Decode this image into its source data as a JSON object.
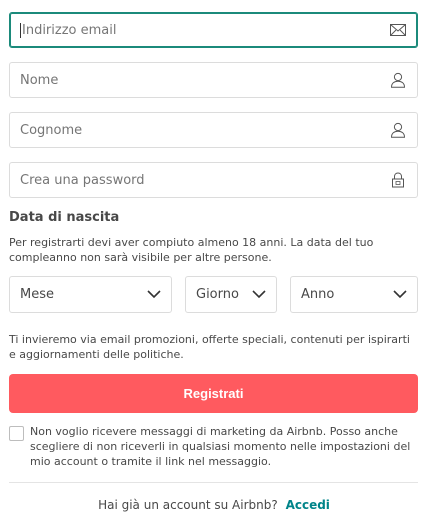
{
  "form": {
    "email": {
      "placeholder": "Indirizzo email",
      "icon": "mail-icon"
    },
    "first_name": {
      "placeholder": "Nome",
      "icon": "user-icon"
    },
    "last_name": {
      "placeholder": "Cognome",
      "icon": "user-icon"
    },
    "password": {
      "placeholder": "Crea una password",
      "icon": "lock-icon"
    }
  },
  "birthdate": {
    "title": "Data di nascita",
    "description": "Per registrarti devi aver compiuto almeno 18 anni. La data del tuo compleanno non sarà visibile per altre persone.",
    "month_label": "Mese",
    "day_label": "Giorno",
    "year_label": "Anno"
  },
  "marketing_notice": "Ti invieremo via email promozioni, offerte speciali, contenuti per ispirarti e aggiornamenti delle politiche.",
  "submit_label": "Registrati",
  "opt_out": {
    "checked": false,
    "label": "Non voglio ricevere messaggi di marketing da Airbnb. Posso anche scegliere di non riceverli in qualsiasi momento nelle impostazioni del mio account o tramite il link nel messaggio."
  },
  "footer": {
    "prompt": "Hai già un account su Airbnb?",
    "login_label": "Accedi"
  },
  "colors": {
    "primary": "#ff5a5f",
    "link": "#008489",
    "focus": "#1b8a7b"
  }
}
